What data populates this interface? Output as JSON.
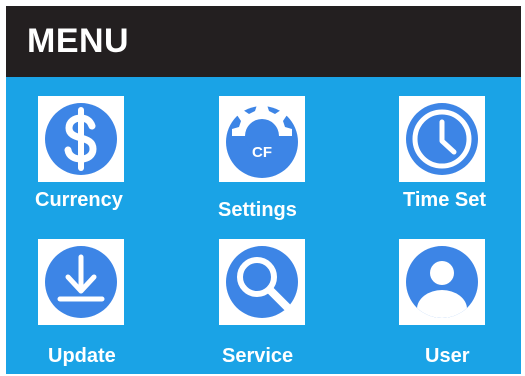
{
  "header": {
    "title": "MENU"
  },
  "menu": {
    "items": [
      {
        "label": "Currency",
        "icon": "currency-dollar-icon"
      },
      {
        "label": "Settings",
        "icon": "settings-gear-icon",
        "badge": "CF"
      },
      {
        "label": "Time Set",
        "icon": "clock-icon"
      },
      {
        "label": "Update",
        "icon": "download-icon"
      },
      {
        "label": "Service",
        "icon": "search-icon"
      },
      {
        "label": "User",
        "icon": "user-icon"
      }
    ]
  },
  "colors": {
    "background": "#1aa3e6",
    "header": "#231f20",
    "icon_fill": "#3d85e6",
    "text": "#ffffff"
  }
}
